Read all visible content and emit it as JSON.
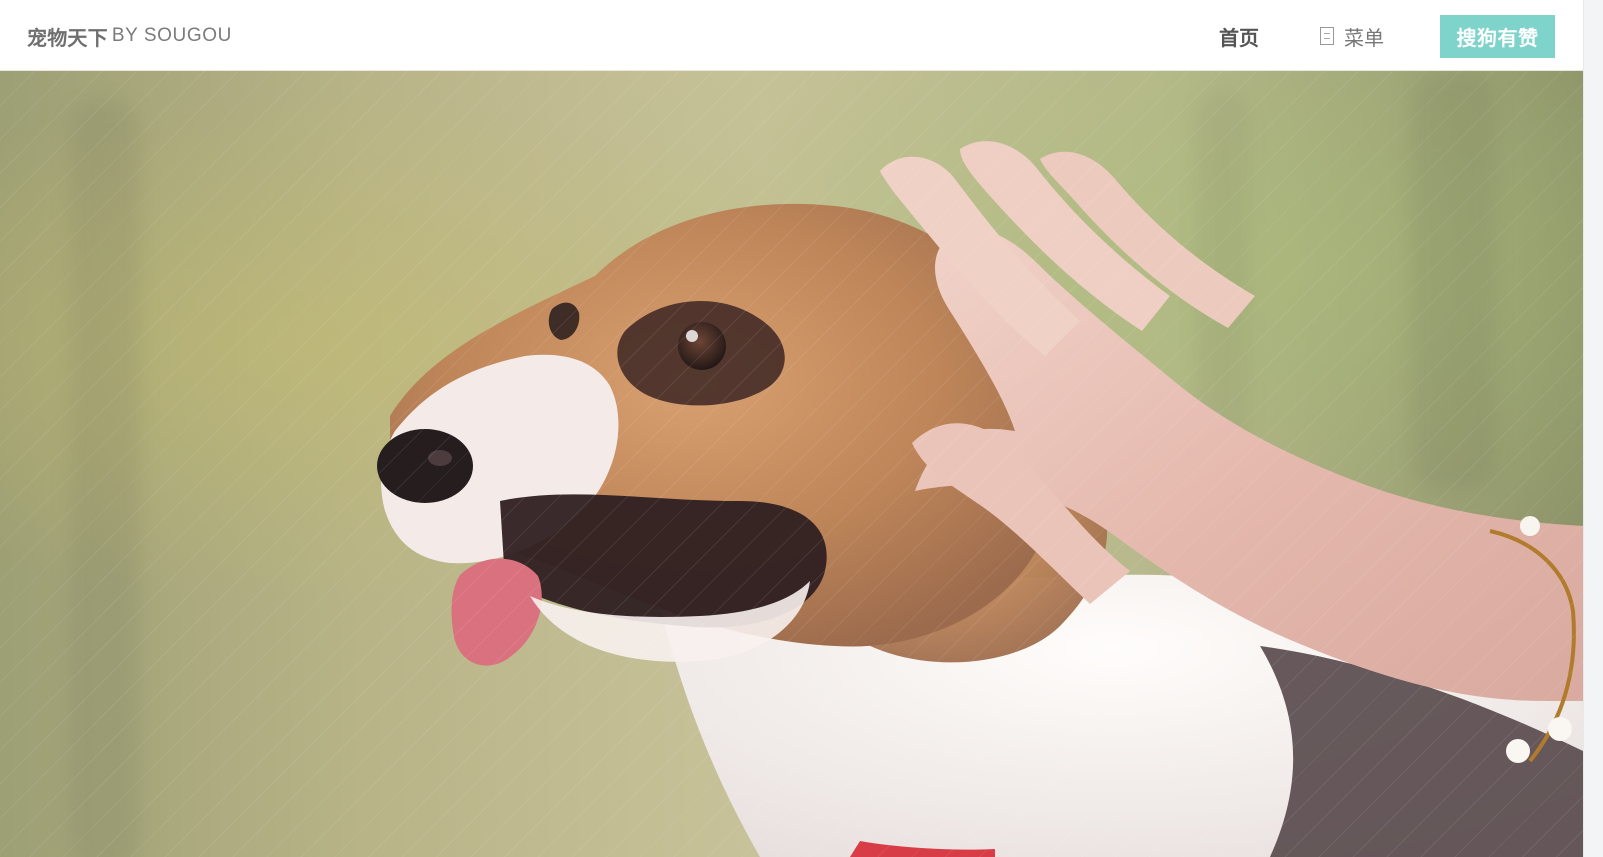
{
  "header": {
    "brand": {
      "strong": "宠物天下",
      "light": "BY SOUGOU"
    },
    "nav": {
      "home": "首页",
      "menu_label": "菜单",
      "cta": "搜狗有赞"
    }
  },
  "icons": {
    "menu_icon": "menu-icon"
  },
  "colors": {
    "accent": "#7ed3cb",
    "header_bg": "#ffffff"
  }
}
